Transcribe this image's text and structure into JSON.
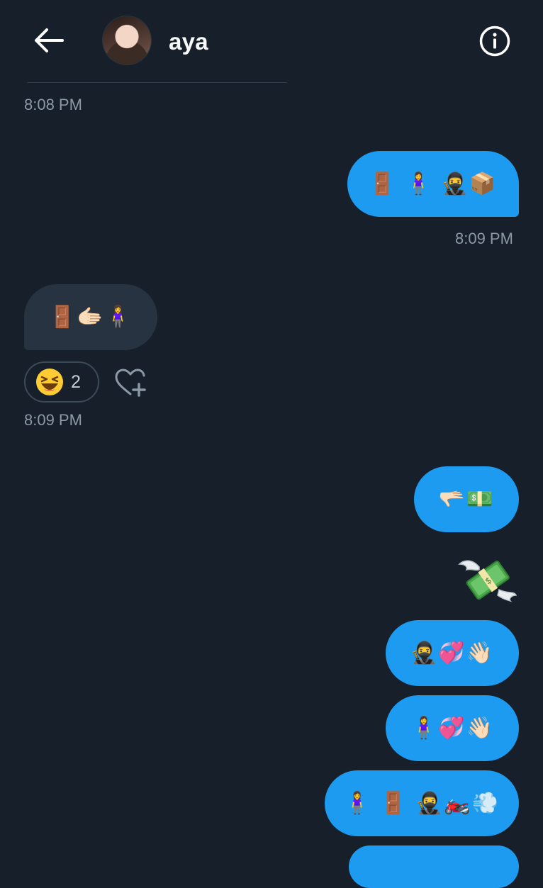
{
  "header": {
    "contact_name": "aya",
    "icons": {
      "back": "arrow-left-icon",
      "info": "info-circle-icon",
      "avatar": "profile-photo"
    }
  },
  "messages": [
    {
      "type": "timestamp",
      "text": "8:08 PM"
    },
    {
      "type": "outgoing",
      "content": "🚪 🧍‍♀️ 🥷📦"
    },
    {
      "type": "timestamp",
      "text": "8:09 PM"
    },
    {
      "type": "incoming",
      "content": "🚪🫱🏻🧍‍♀️"
    },
    {
      "type": "reaction",
      "emoji": "laughing-face",
      "count": "2",
      "add_icon": "heart-plus-icon"
    },
    {
      "type": "timestamp",
      "text": "8:09 PM"
    },
    {
      "type": "outgoing",
      "content": "🫳🏻💵"
    },
    {
      "type": "sticker",
      "emoji": "💸"
    },
    {
      "type": "outgoing",
      "content": "🥷💞👋🏻"
    },
    {
      "type": "outgoing",
      "content": "🧍‍♀️💞👋🏻"
    },
    {
      "type": "outgoing",
      "content": "🧍‍♀️ 🚪 🥷🏍️💨"
    }
  ],
  "colors": {
    "background": "#17202a",
    "outgoing_bubble": "#1d9bf0",
    "incoming_bubble": "#273340",
    "timestamp": "#8b98a5"
  }
}
